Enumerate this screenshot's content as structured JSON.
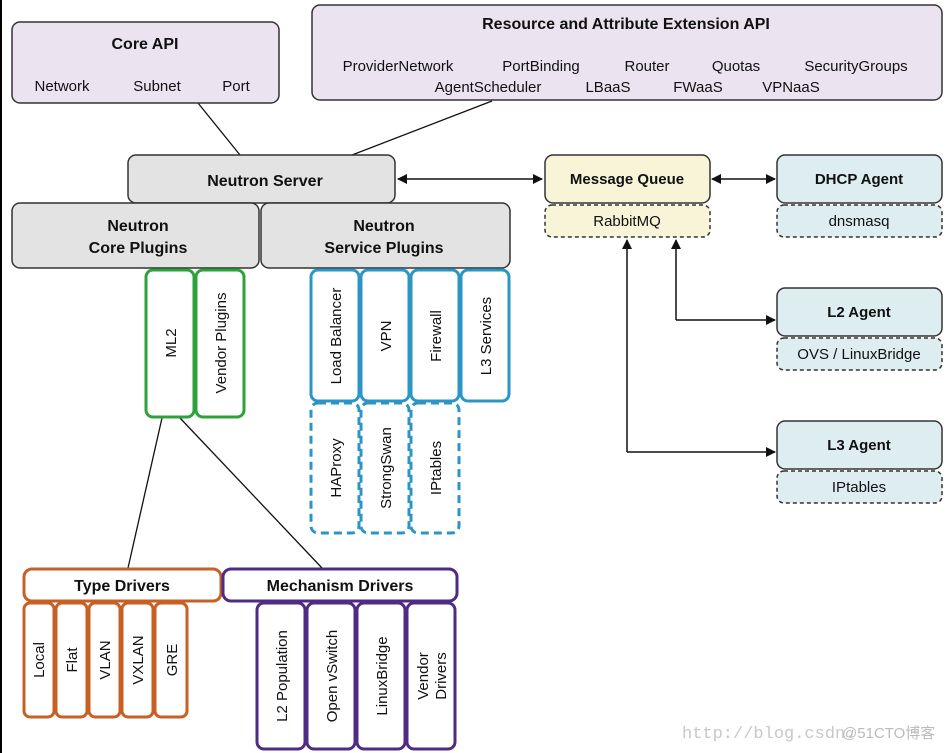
{
  "core_api": {
    "title": "Core API",
    "items": [
      "Network",
      "Subnet",
      "Port"
    ]
  },
  "extension_api": {
    "title": "Resource and Attribute Extension API",
    "row1": [
      "ProviderNetwork",
      "PortBinding",
      "Router",
      "Quotas",
      "SecurityGroups"
    ],
    "row2": [
      "AgentScheduler",
      "LBaaS",
      "FWaaS",
      "VPNaaS"
    ]
  },
  "neutron_server": {
    "title": "Neutron Server"
  },
  "core_plugins": {
    "line1": "Neutron",
    "line2": "Core Plugins",
    "items": [
      "ML2",
      "Vendor Plugins"
    ]
  },
  "service_plugins": {
    "line1": "Neutron",
    "line2": "Service Plugins",
    "items": [
      "Load Balancer",
      "VPN",
      "Firewall",
      "L3 Services"
    ],
    "backends": [
      "HAProxy",
      "StrongSwan",
      "IPtables"
    ]
  },
  "message_queue": {
    "title": "Message Queue",
    "impl": "RabbitMQ"
  },
  "agents": [
    {
      "title": "DHCP Agent",
      "impl": "dnsmasq"
    },
    {
      "title": "L2 Agent",
      "impl": "OVS / LinuxBridge"
    },
    {
      "title": "L3 Agent",
      "impl": "IPtables"
    }
  ],
  "type_drivers": {
    "title": "Type Drivers",
    "items": [
      "Local",
      "Flat",
      "VLAN",
      "VXLAN",
      "GRE"
    ]
  },
  "mechanism_drivers": {
    "title": "Mechanism Drivers",
    "items": [
      "L2 Population",
      "Open vSwitch",
      "LinuxBridge",
      "Vendor",
      "Drivers"
    ]
  },
  "watermark": {
    "url": "http://blog.csdn.",
    "brand": "@51CTO博客"
  },
  "colors": {
    "api_fill": "#ebe3f0",
    "server_fill": "#e3e3e3",
    "mq_fill": "#f7f4d8",
    "agent_fill": "#ddedf0",
    "green": "#2ea23a",
    "blue": "#2b95c6",
    "orange": "#c85f23",
    "purple": "#4f2b84"
  }
}
